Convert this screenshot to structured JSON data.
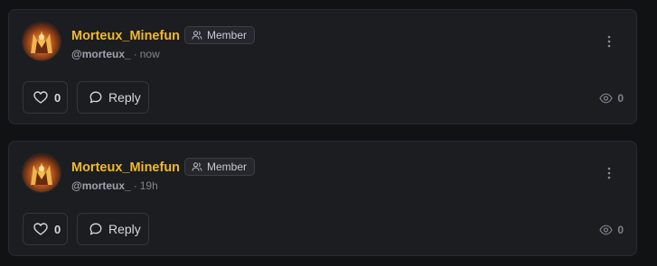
{
  "posts": [
    {
      "author": {
        "display_name": "Morteux_Minefun",
        "handle": "@morteux_",
        "role": "Member",
        "avatar_icon": "avatar-image"
      },
      "time": "now",
      "separator": "·",
      "likes": "0",
      "reply_label": "Reply",
      "views": "0"
    },
    {
      "author": {
        "display_name": "Morteux_Minefun",
        "handle": "@morteux_",
        "role": "Member",
        "avatar_icon": "avatar-image"
      },
      "time": "19h",
      "separator": "·",
      "likes": "0",
      "reply_label": "Reply",
      "views": "0"
    }
  ],
  "colors": {
    "background": "#111214",
    "card": "#1c1d21",
    "username": "#f1b92c",
    "muted_text": "#7f838c",
    "button_border": "#34363c"
  },
  "icons": {
    "role": "user-group-icon",
    "more": "more-vertical-icon",
    "like": "heart-icon",
    "reply": "chat-bubble-icon",
    "views": "eye-icon"
  }
}
